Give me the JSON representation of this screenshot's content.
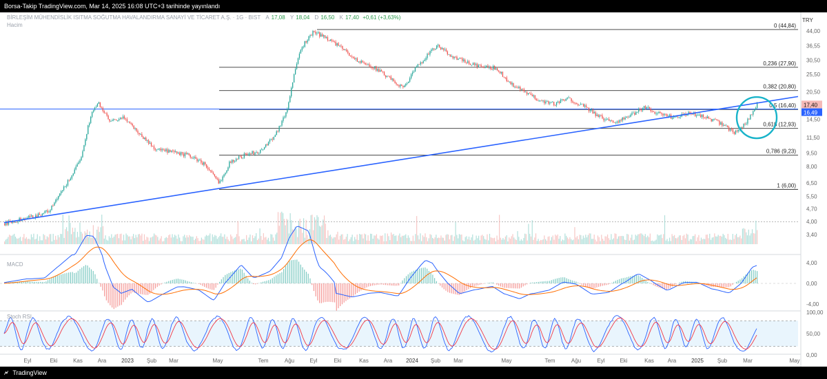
{
  "header": {
    "title": "Borsa-Takip TradingView.com, Mar 14, 2025 16:08 UTC+3 tarihinde yayınlandı"
  },
  "legend": {
    "symbol": "BİRLEŞİM MÜHENDİSLİK ISITMA SOĞUTMA HAVALANDIRMA SANAYİ VE TİCARET A.Ş. · 1G · BIST",
    "open_label": "A",
    "open": "17,08",
    "high_label": "Y",
    "high": "18,04",
    "low_label": "D",
    "low": "16,50",
    "close_label": "K",
    "close": "17,40",
    "change": "+0,61 (+3,63%)",
    "volume_label": "Hacim"
  },
  "currency": "TRY",
  "macd_label": "MACD",
  "stoch_label": "Stoch RSI",
  "footer": {
    "brand": "TradingView",
    "logo": "tv-logo-icon"
  },
  "colors": {
    "up": "#26a69a",
    "down": "#ef5350",
    "trend": "#2962ff",
    "circle": "#18b3c9",
    "macd": "#2962ff",
    "signal": "#ff6d00",
    "stoch_k": "#2962ff",
    "stoch_d": "#f23645"
  },
  "chart_data": [
    {
      "type": "candlestick",
      "x_ticks": [
        "Eyl",
        "Eki",
        "Kas",
        "Ara",
        "2023",
        "Şub",
        "Mar",
        "May",
        "Tem",
        "Ağu",
        "Eyl",
        "Eki",
        "Kas",
        "Ara",
        "2024",
        "Şub",
        "Mar",
        "May",
        "Tem",
        "Ağu",
        "Eyl",
        "Eki",
        "Kas",
        "Ara",
        "2025",
        "Şub",
        "Mar",
        "May"
      ],
      "y_ticks": [
        "44,00",
        "36,55",
        "30,50",
        "25,50",
        "20,50",
        "17,40",
        "16,49",
        "14,50",
        "11,50",
        "9,50",
        "8,00",
        "6,50",
        "5,50",
        "4,70",
        "4,00",
        "3,40"
      ],
      "y_scale": "log",
      "ylim": [
        3.2,
        46
      ],
      "price_path": [
        {
          "t": 0,
          "p": 3.9
        },
        {
          "t": 0.01,
          "p": 4.0
        },
        {
          "t": 0.04,
          "p": 4.3
        },
        {
          "t": 0.06,
          "p": 4.6
        },
        {
          "t": 0.08,
          "p": 6.2
        },
        {
          "t": 0.1,
          "p": 8.5
        },
        {
          "t": 0.115,
          "p": 15.5
        },
        {
          "t": 0.125,
          "p": 17.8
        },
        {
          "t": 0.14,
          "p": 14.0
        },
        {
          "t": 0.16,
          "p": 14.8
        },
        {
          "t": 0.18,
          "p": 12.0
        },
        {
          "t": 0.2,
          "p": 10.0
        },
        {
          "t": 0.22,
          "p": 9.6
        },
        {
          "t": 0.245,
          "p": 9.2
        },
        {
          "t": 0.265,
          "p": 8.3
        },
        {
          "t": 0.285,
          "p": 6.5
        },
        {
          "t": 0.3,
          "p": 8.5
        },
        {
          "t": 0.32,
          "p": 9.3
        },
        {
          "t": 0.34,
          "p": 9.7
        },
        {
          "t": 0.36,
          "p": 12.0
        },
        {
          "t": 0.375,
          "p": 16.0
        },
        {
          "t": 0.385,
          "p": 26.0
        },
        {
          "t": 0.395,
          "p": 36.0
        },
        {
          "t": 0.41,
          "p": 43.5
        },
        {
          "t": 0.43,
          "p": 40.0
        },
        {
          "t": 0.45,
          "p": 35.0
        },
        {
          "t": 0.47,
          "p": 30.0
        },
        {
          "t": 0.49,
          "p": 28.0
        },
        {
          "t": 0.51,
          "p": 24.5
        },
        {
          "t": 0.53,
          "p": 21.5
        },
        {
          "t": 0.545,
          "p": 27.0
        },
        {
          "t": 0.56,
          "p": 32.0
        },
        {
          "t": 0.575,
          "p": 36.5
        },
        {
          "t": 0.595,
          "p": 32.0
        },
        {
          "t": 0.615,
          "p": 29.5
        },
        {
          "t": 0.635,
          "p": 28.0
        },
        {
          "t": 0.655,
          "p": 27.5
        },
        {
          "t": 0.67,
          "p": 23.0
        },
        {
          "t": 0.69,
          "p": 20.5
        },
        {
          "t": 0.71,
          "p": 18.5
        },
        {
          "t": 0.73,
          "p": 17.6
        },
        {
          "t": 0.75,
          "p": 18.8
        },
        {
          "t": 0.77,
          "p": 17.0
        },
        {
          "t": 0.79,
          "p": 15.0
        },
        {
          "t": 0.81,
          "p": 14.0
        },
        {
          "t": 0.83,
          "p": 15.0
        },
        {
          "t": 0.85,
          "p": 17.0
        },
        {
          "t": 0.87,
          "p": 15.5
        },
        {
          "t": 0.89,
          "p": 14.8
        },
        {
          "t": 0.91,
          "p": 15.6
        },
        {
          "t": 0.93,
          "p": 15.0
        },
        {
          "t": 0.95,
          "p": 13.8
        },
        {
          "t": 0.97,
          "p": 12.3
        },
        {
          "t": 0.985,
          "p": 13.8
        },
        {
          "t": 1.0,
          "p": 17.4
        }
      ],
      "fibonacci": [
        {
          "label": "0 (44,84)",
          "value": 44.84
        },
        {
          "label": "0,236 (27,90)",
          "value": 27.9
        },
        {
          "label": "0,382 (20,80)",
          "value": 20.8
        },
        {
          "label": "0,5 (16,40)",
          "value": 16.4
        },
        {
          "label": "0,618 (12,93)",
          "value": 12.93
        },
        {
          "label": "0,786 (9,23)",
          "value": 9.23
        },
        {
          "label": "1 (6,00)",
          "value": 6.0
        }
      ],
      "last_price": "17,40",
      "horizontal_line": "16,49",
      "dotted_level": 4.0
    },
    {
      "type": "line",
      "name": "MACD",
      "y_ticks": [
        "4,00",
        "0,00",
        "-4,00"
      ],
      "ylim": [
        -4.8,
        4.8
      ]
    },
    {
      "type": "line",
      "name": "Stoch RSI",
      "y_ticks": [
        "100,00",
        "50,00",
        "0,00"
      ],
      "ylim": [
        0,
        100
      ]
    }
  ]
}
